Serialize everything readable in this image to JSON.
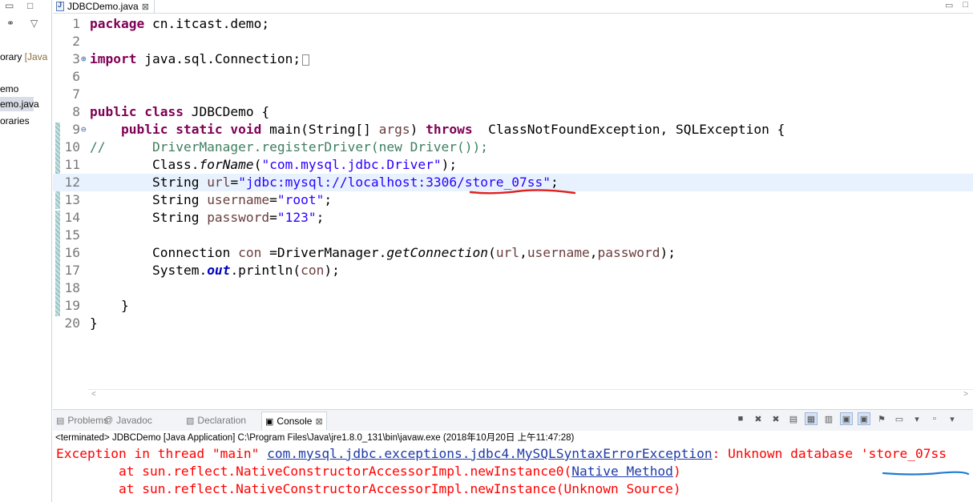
{
  "left_pane": {
    "items": [
      {
        "label": "orary",
        "suffix": " [Java"
      },
      {
        "label": "emo"
      },
      {
        "label": "emo.java"
      },
      {
        "label": "oraries"
      }
    ]
  },
  "editor": {
    "tab_label": "JDBCDemo.java",
    "tab_close": "⊠",
    "lines": [
      {
        "n": "1",
        "segments": [
          {
            "c": "kw",
            "t": "package"
          },
          {
            "c": "",
            "t": " cn.itcast.demo;"
          }
        ]
      },
      {
        "n": "2",
        "segments": []
      },
      {
        "n": "3",
        "fold": "⊕",
        "segments": [
          {
            "c": "kw",
            "t": "import"
          },
          {
            "c": "",
            "t": " java.sql.Connection;"
          }
        ],
        "collapsed": true
      },
      {
        "n": "6",
        "segments": []
      },
      {
        "n": "7",
        "segments": []
      },
      {
        "n": "8",
        "segments": [
          {
            "c": "kw",
            "t": "public class"
          },
          {
            "c": "",
            "t": " JDBCDemo {"
          }
        ]
      },
      {
        "n": "9",
        "fold": "⊖",
        "segments": [
          {
            "c": "",
            "t": "    "
          },
          {
            "c": "kw",
            "t": "public static void"
          },
          {
            "c": "",
            "t": " main(String[] "
          },
          {
            "c": "var",
            "t": "args"
          },
          {
            "c": "",
            "t": ") "
          },
          {
            "c": "kw",
            "t": "throws"
          },
          {
            "c": "",
            "t": "  ClassNotFoundException, SQLException {"
          }
        ]
      },
      {
        "n": "10",
        "segments": [
          {
            "c": "com",
            "t": "//      DriverManager.registerDriver(new Driver());"
          }
        ]
      },
      {
        "n": "11",
        "segments": [
          {
            "c": "",
            "t": "        Class."
          },
          {
            "c": "ital",
            "t": "forName"
          },
          {
            "c": "",
            "t": "("
          },
          {
            "c": "str",
            "t": "\"com.mysql.jdbc.Driver\""
          },
          {
            "c": "",
            "t": ");"
          }
        ]
      },
      {
        "n": "12",
        "current": true,
        "segments": [
          {
            "c": "",
            "t": "        String "
          },
          {
            "c": "var",
            "t": "url"
          },
          {
            "c": "",
            "t": "="
          },
          {
            "c": "str",
            "t": "\"jdbc:mysql://localhost:3306/store_07ss\""
          },
          {
            "c": "",
            "t": ";"
          }
        ]
      },
      {
        "n": "13",
        "segments": [
          {
            "c": "",
            "t": "        String "
          },
          {
            "c": "var",
            "t": "username"
          },
          {
            "c": "",
            "t": "="
          },
          {
            "c": "str",
            "t": "\"root\""
          },
          {
            "c": "",
            "t": ";"
          }
        ]
      },
      {
        "n": "14",
        "segments": [
          {
            "c": "",
            "t": "        String "
          },
          {
            "c": "var",
            "t": "password"
          },
          {
            "c": "",
            "t": "="
          },
          {
            "c": "str",
            "t": "\"123\""
          },
          {
            "c": "",
            "t": ";"
          }
        ]
      },
      {
        "n": "15",
        "segments": []
      },
      {
        "n": "16",
        "segments": [
          {
            "c": "",
            "t": "        Connection "
          },
          {
            "c": "var",
            "t": "con"
          },
          {
            "c": "",
            "t": " =DriverManager."
          },
          {
            "c": "ital",
            "t": "getConnection"
          },
          {
            "c": "",
            "t": "("
          },
          {
            "c": "var",
            "t": "url"
          },
          {
            "c": "",
            "t": ","
          },
          {
            "c": "var",
            "t": "username"
          },
          {
            "c": "",
            "t": ","
          },
          {
            "c": "var",
            "t": "password"
          },
          {
            "c": "",
            "t": ");"
          }
        ]
      },
      {
        "n": "17",
        "segments": [
          {
            "c": "",
            "t": "        System."
          },
          {
            "c": "field",
            "t": "out"
          },
          {
            "c": "",
            "t": ".println("
          },
          {
            "c": "var",
            "t": "con"
          },
          {
            "c": "",
            "t": ");"
          }
        ]
      },
      {
        "n": "18",
        "segments": []
      },
      {
        "n": "19",
        "segments": [
          {
            "c": "",
            "t": "    }"
          }
        ]
      },
      {
        "n": "20",
        "segments": [
          {
            "c": "",
            "t": "}"
          }
        ]
      }
    ]
  },
  "console_tabs": [
    {
      "label": "Problems",
      "icon": "▤"
    },
    {
      "label": "Javadoc",
      "icon": "@"
    },
    {
      "label": "Declaration",
      "icon": "▧"
    },
    {
      "label": "Console",
      "icon": "▣",
      "active": true
    }
  ],
  "console_tab_close": "⊠",
  "console": {
    "header": "<terminated> JDBCDemo [Java Application] C:\\Program Files\\Java\\jre1.8.0_131\\bin\\javaw.exe (2018年10月20日 上午11:47:28)",
    "line1_prefix": "Exception in thread \"main\" ",
    "line1_link": "com.mysql.jdbc.exceptions.jdbc4.MySQLSyntaxErrorException",
    "line1_suffix": ": Unknown database 'store_07ss",
    "line2_prefix": "\tat sun.reflect.NativeConstructorAccessorImpl.newInstance0(",
    "line2_link": "Native Method",
    "line2_suffix": ")",
    "line3": "\tat sun.reflect.NativeConstructorAccessorImpl.newInstance(Unknown Source)"
  },
  "colors": {
    "keyword": "#7f0055",
    "string": "#2a00ff",
    "variable": "#6a3e3e",
    "comment": "#3f7f5f",
    "error": "#ff0000",
    "link": "#1f3aa8",
    "current_line": "#e8f2fe"
  }
}
